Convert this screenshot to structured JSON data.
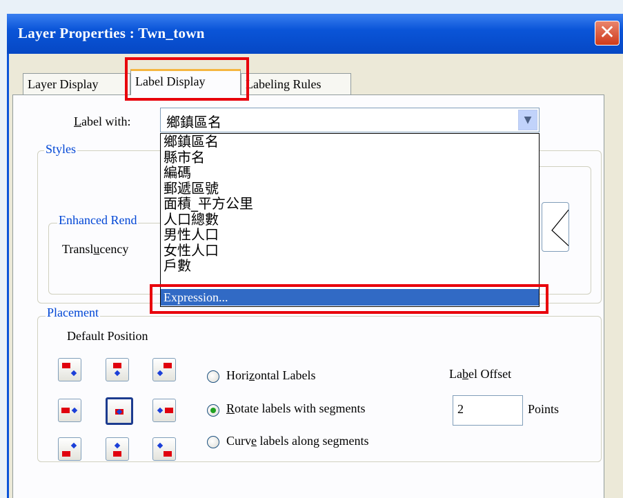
{
  "window": {
    "title": "Layer Properties  : Twn_town",
    "close_label": "✕"
  },
  "tabs": [
    {
      "label": "Layer Display",
      "active": false
    },
    {
      "label": "Label Display",
      "active": true
    },
    {
      "label": "Labeling Rules",
      "active": false
    }
  ],
  "label_with": {
    "label_pre": "",
    "label_u": "L",
    "label_post": "abel with:",
    "selected": "鄉鎮區名",
    "options": [
      "鄉鎮區名",
      "縣市名",
      "編碼",
      "郵遞區號",
      "面積_平方公里",
      "人口總數",
      "男性人口",
      "女性人口",
      "戶數"
    ],
    "highlighted_option": "Expression..."
  },
  "styles": {
    "legend": "Styles",
    "enhanced_legend": "Enhanced Rend",
    "translucency_pre": "Transl",
    "translucency_u": "u",
    "translucency_post": "cency"
  },
  "placement": {
    "legend": "Placement",
    "default_position": "Default Position",
    "radios": [
      {
        "pre": "Hori",
        "u": "z",
        "post": "ontal Labels",
        "checked": false
      },
      {
        "pre": "",
        "u": "R",
        "post": "otate labels with segments",
        "checked": true
      },
      {
        "pre": "Curv",
        "u": "e",
        "post": " labels along segments",
        "checked": false
      }
    ],
    "label_offset_pre": "La",
    "label_offset_u": "b",
    "label_offset_post": "el Offset",
    "offset_value": "2",
    "offset_unit": "Points"
  },
  "colors": {
    "title_bar": "#0a53d8",
    "highlight": "#e8000b",
    "selection": "#316ac5",
    "legend_text": "#0046d5"
  }
}
